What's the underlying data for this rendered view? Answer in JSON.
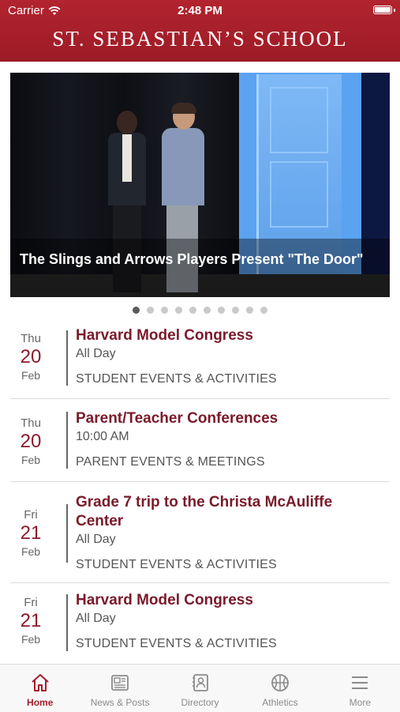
{
  "status_bar": {
    "carrier": "Carrier",
    "time": "2:48 PM"
  },
  "header": {
    "title": "ST. SEBASTIAN’S SCHOOL"
  },
  "hero": {
    "caption": "The Slings and Arrows Players Present \"The Door\"",
    "slide_count": 10,
    "active_slide": 1
  },
  "events": [
    {
      "dow": "Thu",
      "day": "20",
      "month": "Feb",
      "title": "Harvard Model Congress",
      "time": "All Day",
      "category": "STUDENT EVENTS & ACTIVITIES"
    },
    {
      "dow": "Thu",
      "day": "20",
      "month": "Feb",
      "title": "Parent/Teacher Conferences",
      "time": "10:00 AM",
      "category": "PARENT EVENTS & MEETINGS"
    },
    {
      "dow": "Fri",
      "day": "21",
      "month": "Feb",
      "title": "Grade 7 trip to the Christa McAuliffe Center",
      "time": "All Day",
      "category": "STUDENT EVENTS & ACTIVITIES"
    },
    {
      "dow": "Fri",
      "day": "21",
      "month": "Feb",
      "title": "Harvard Model Congress",
      "time": "All Day",
      "category": "STUDENT EVENTS & ACTIVITIES"
    }
  ],
  "tabs": [
    {
      "label": "Home",
      "icon": "home-icon",
      "active": true
    },
    {
      "label": "News & Posts",
      "icon": "newspaper-icon",
      "active": false
    },
    {
      "label": "Directory",
      "icon": "directory-icon",
      "active": false
    },
    {
      "label": "Athletics",
      "icon": "basketball-icon",
      "active": false
    },
    {
      "label": "More",
      "icon": "menu-icon",
      "active": false
    }
  ],
  "colors": {
    "brand": "#a31e2c",
    "event_title": "#7a1a2b",
    "date_day": "#8c1a2b"
  }
}
